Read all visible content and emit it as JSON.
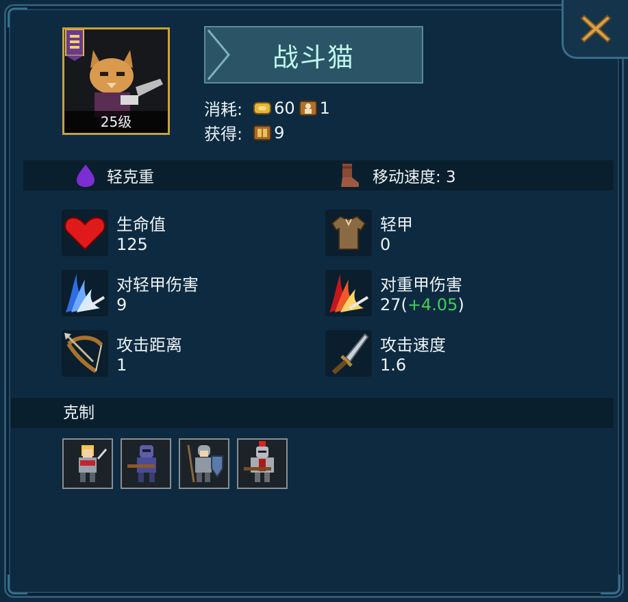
{
  "unit": {
    "name": "战斗猫",
    "level_label": "25级",
    "cost_label": "消耗:",
    "cost_gold": "60",
    "cost_pop": "1",
    "gain_label": "获得:",
    "gain_value": "9",
    "weight_class": "轻克重",
    "move_speed": "移动速度: 3"
  },
  "stats": {
    "hp": {
      "name": "生命值",
      "value": "125"
    },
    "armor": {
      "name": "轻甲",
      "value": "0"
    },
    "dmg_light": {
      "name": "对轻甲伤害",
      "value": "9"
    },
    "dmg_heavy": {
      "name": "对重甲伤害",
      "value_base": "27(",
      "value_bonus": "+4.05",
      "value_close": ")"
    },
    "range": {
      "name": "攻击距离",
      "value": "1"
    },
    "speed": {
      "name": "攻击速度",
      "value": "1.6"
    }
  },
  "counter": {
    "label": "克制",
    "units": [
      "blonde-knight",
      "purple-crossbowman",
      "shield-spearman",
      "red-plumed-knight"
    ]
  },
  "icons": {
    "close": "close-x-icon",
    "weight": "purple-drop-icon",
    "move": "boot-icon",
    "hp": "heart-icon",
    "armor": "leather-tunic-icon",
    "dmg_light": "blue-claw-slash-icon",
    "dmg_heavy": "red-claw-slash-icon",
    "range": "bow-icon",
    "speed": "dagger-icon"
  },
  "colors": {
    "bonus": "#3bd15a",
    "title": "#bff6ec",
    "frame_gold": "#c9a23c",
    "close_x": "#d8a04a"
  }
}
